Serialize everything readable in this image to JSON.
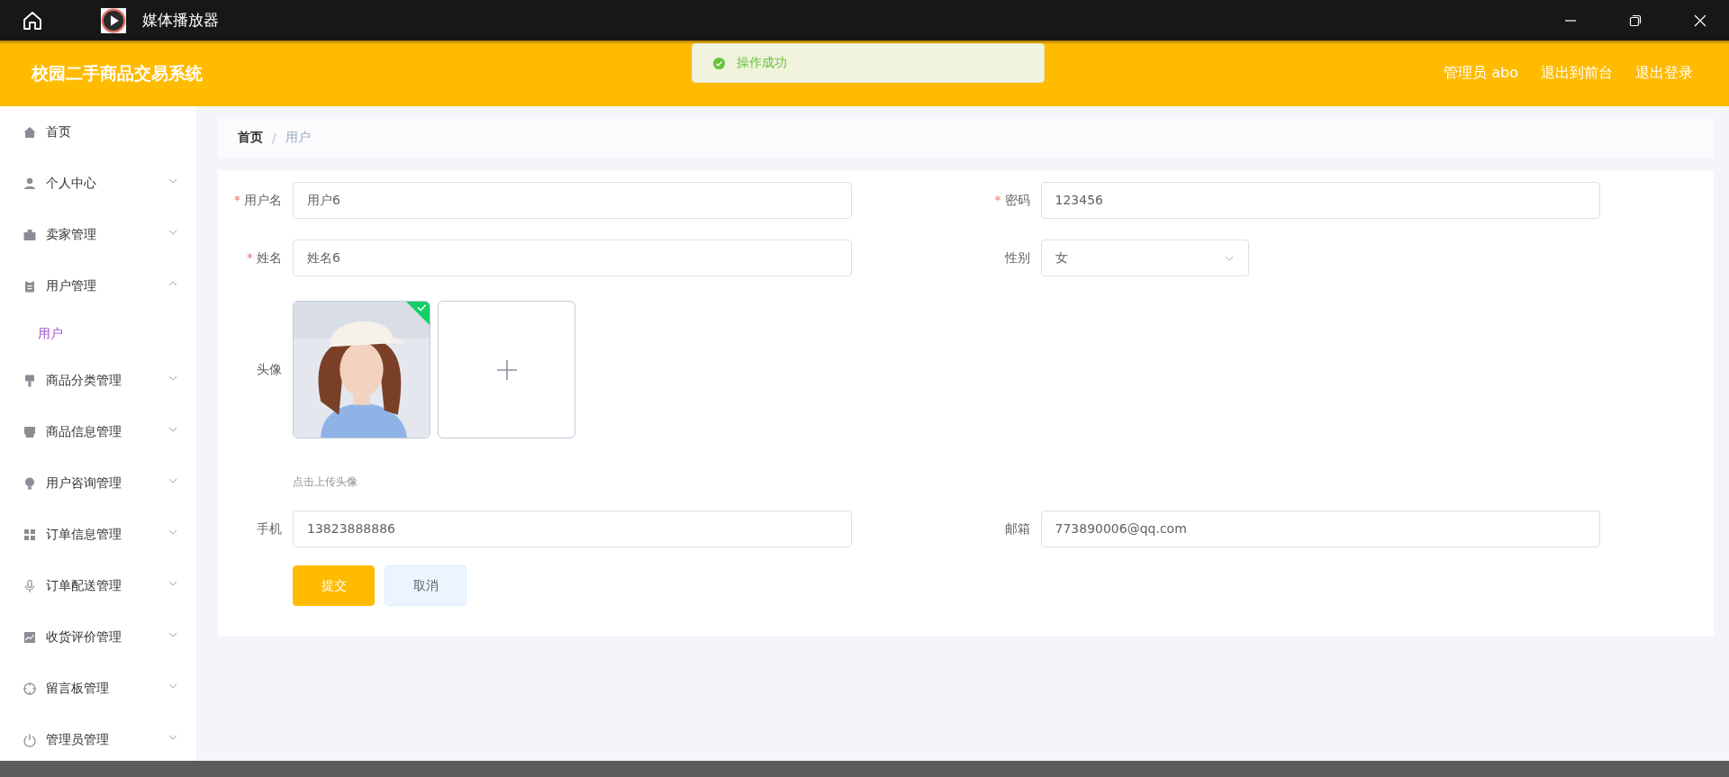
{
  "window": {
    "title": "媒体播放器"
  },
  "header": {
    "title": "校园二手商品交易系统",
    "links": [
      "管理员 abo",
      "退出到前台",
      "退出登录"
    ]
  },
  "toast": {
    "kind": "success",
    "message": "操作成功"
  },
  "sidebar": {
    "items": [
      {
        "label": "首页",
        "kind": "link"
      },
      {
        "label": "个人中心",
        "kind": "menu",
        "expanded": false
      },
      {
        "label": "卖家管理",
        "kind": "menu",
        "expanded": false
      },
      {
        "label": "用户管理",
        "kind": "menu",
        "expanded": true,
        "children": [
          {
            "label": "用户",
            "selected": true
          }
        ]
      },
      {
        "label": "商品分类管理",
        "kind": "menu",
        "expanded": false
      },
      {
        "label": "商品信息管理",
        "kind": "menu",
        "expanded": false
      },
      {
        "label": "用户咨询管理",
        "kind": "menu",
        "expanded": false
      },
      {
        "label": "订单信息管理",
        "kind": "menu",
        "expanded": false
      },
      {
        "label": "订单配送管理",
        "kind": "menu",
        "expanded": false
      },
      {
        "label": "收货评价管理",
        "kind": "menu",
        "expanded": false
      },
      {
        "label": "留言板管理",
        "kind": "menu",
        "expanded": false
      },
      {
        "label": "管理员管理",
        "kind": "menu",
        "expanded": false
      }
    ]
  },
  "breadcrumb": {
    "items": [
      "首页",
      "用户"
    ],
    "separator": "/"
  },
  "form": {
    "required_mark": "*",
    "rows": [
      {
        "fields": [
          {
            "kind": "input",
            "label": "用户名",
            "required": true,
            "value": "用户6"
          },
          {
            "kind": "input",
            "label": "密码",
            "required": true,
            "value": "123456"
          }
        ]
      },
      {
        "fields": [
          {
            "kind": "input",
            "label": "姓名",
            "required": true,
            "value": "姓名6"
          },
          {
            "kind": "select",
            "label": "性别",
            "required": false,
            "value": "女"
          }
        ]
      },
      {
        "fields": [
          {
            "kind": "upload",
            "label": "头像",
            "required": false,
            "uploaded": true,
            "hint": "点击上传头像"
          }
        ]
      },
      {
        "fields": [
          {
            "kind": "input",
            "label": "手机",
            "required": false,
            "value": "13823888886"
          },
          {
            "kind": "input",
            "label": "邮箱",
            "required": false,
            "value": "773890006@qq.com"
          }
        ]
      }
    ],
    "buttons": [
      {
        "label": "提交",
        "kind": "primary"
      },
      {
        "label": "取消",
        "kind": "plain"
      }
    ]
  }
}
